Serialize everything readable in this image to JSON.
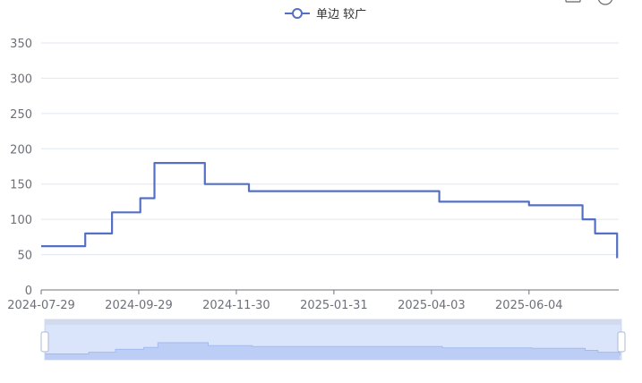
{
  "chart_data": {
    "type": "line",
    "title": "",
    "xlabel": "",
    "ylabel": "",
    "ylim": [
      0,
      350
    ],
    "yticks": [
      0,
      50,
      100,
      150,
      200,
      250,
      300,
      350
    ],
    "xlim": [
      "2024-07-29",
      "2025-07-31"
    ],
    "xticks": [
      "2024-07-29",
      "2024-09-29",
      "2024-11-30",
      "2025-01-31",
      "2025-04-03",
      "2025-06-04"
    ],
    "grid": true,
    "step": true,
    "legend_position": "top-center",
    "series": [
      {
        "name": "单边 较广",
        "color": "#5470c6",
        "points": [
          {
            "x": "2024-07-29",
            "y": 62
          },
          {
            "x": "2024-08-26",
            "y": 80
          },
          {
            "x": "2024-09-12",
            "y": 110
          },
          {
            "x": "2024-09-30",
            "y": 130
          },
          {
            "x": "2024-10-09",
            "y": 180
          },
          {
            "x": "2024-11-10",
            "y": 150
          },
          {
            "x": "2024-12-08",
            "y": 140
          },
          {
            "x": "2025-04-08",
            "y": 125
          },
          {
            "x": "2025-06-04",
            "y": 120
          },
          {
            "x": "2025-07-08",
            "y": 100
          },
          {
            "x": "2025-07-16",
            "y": 80
          },
          {
            "x": "2025-07-27",
            "y": 80
          },
          {
            "x": "2025-07-30",
            "y": 45
          }
        ]
      }
    ],
    "data_zoom": {
      "start": "2024-07-29",
      "end": "2025-07-31"
    }
  }
}
